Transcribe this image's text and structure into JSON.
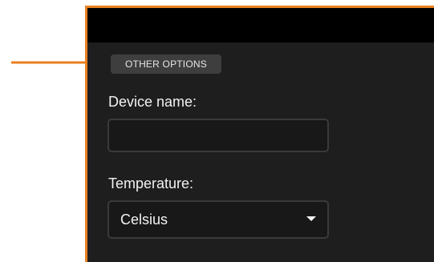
{
  "colors": {
    "accent": "#e8801f",
    "panel_background": "#1e1e1e",
    "header_background": "#000000"
  },
  "section": {
    "label": "OTHER OPTIONS"
  },
  "device_name": {
    "label": "Device name:",
    "value": "",
    "placeholder": ""
  },
  "temperature": {
    "label": "Temperature:",
    "selected": "Celsius",
    "dropdown_icon": "caret-down-icon"
  },
  "callout": {
    "icon": "arrow-right-icon"
  }
}
